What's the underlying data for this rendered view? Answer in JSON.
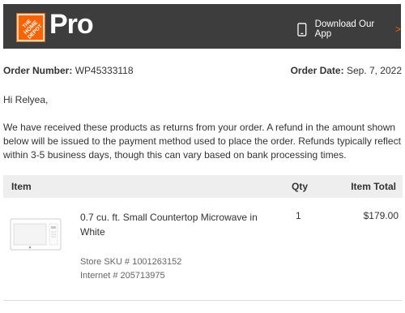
{
  "header": {
    "logo_text": "THE HOME DEPOT",
    "brand_suffix": "Pro",
    "download_label": "Download Our App",
    "download_arrow": ">",
    "accent_color": "#f96302",
    "bar_color": "#3d3d3d"
  },
  "order": {
    "number_label": "Order Number:",
    "number_value": "WP45333118",
    "date_label": "Order Date:",
    "date_value": "Sep. 7, 2022"
  },
  "greeting": "Hi Relyea,",
  "message": "We have received these products as returns from your order. A refund in the amount shown below will be issued to the payment method used to place the order. Refunds typically reflect within 3-5 business days, though this can vary based on bank processing times.",
  "table": {
    "headers": {
      "item": "Item",
      "qty": "Qty",
      "total": "Item Total"
    },
    "rows": [
      {
        "name": "0.7 cu. ft. Small Countertop Microwave in White",
        "store_sku": "Store SKU # 1001263152",
        "internet": "Internet # 205713975",
        "qty": "1",
        "total": "$179.00"
      }
    ]
  }
}
